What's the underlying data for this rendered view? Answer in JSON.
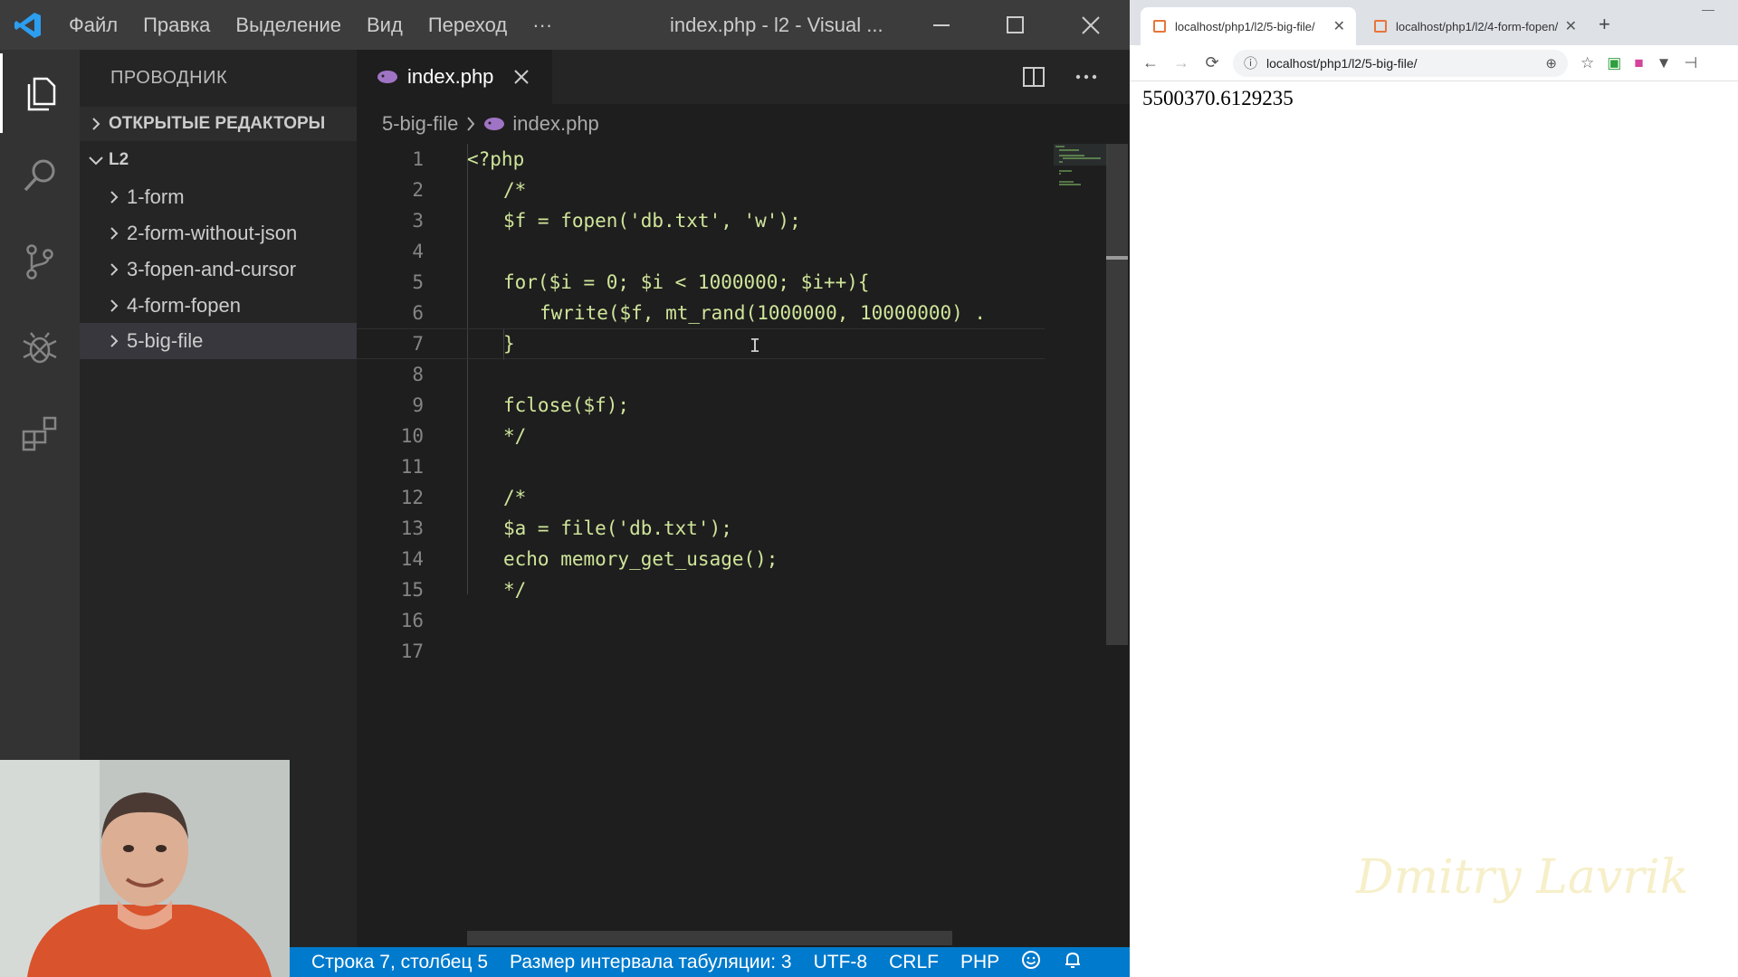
{
  "vscode": {
    "menu": [
      "Файл",
      "Правка",
      "Выделение",
      "Вид",
      "Переход",
      "···"
    ],
    "window_title": "index.php - l2 - Visual ...",
    "sidebar": {
      "header": "ПРОВОДНИК",
      "open_editors": "ОТКРЫТЫЕ РЕДАКТОРЫ",
      "folder": "L2",
      "items": [
        "1-form",
        "2-form-without-json",
        "3-fopen-and-cursor",
        "4-form-fopen",
        "5-big-file"
      ]
    },
    "tab": {
      "label": "index.php"
    },
    "breadcrumb": {
      "folder": "5-big-file",
      "file": "index.php"
    },
    "code": {
      "line_numbers": [
        "1",
        "2",
        "3",
        "4",
        "5",
        "6",
        "7",
        "8",
        "9",
        "10",
        "11",
        "12",
        "13",
        "14",
        "15",
        "16",
        "17"
      ],
      "lines": [
        "<?php",
        "/*",
        "$f = fopen('db.txt', 'w');",
        "",
        "for($i = 0; $i < 1000000; $i++){",
        "fwrite($f, mt_rand(1000000, 10000000) .",
        "}",
        "",
        "fclose($f);",
        "*/",
        "",
        "/*",
        "$a = file('db.txt');",
        "echo memory_get_usage();",
        "*/",
        "",
        ""
      ]
    },
    "status": {
      "position": "Строка 7, столбец 5",
      "tab_size": "Размер интервала табуляции: 3",
      "encoding": "UTF-8",
      "eol": "CRLF",
      "language": "PHP"
    },
    "icons": {
      "activity": [
        "explorer-icon",
        "search-icon",
        "source-control-icon",
        "debug-icon",
        "extensions-icon"
      ]
    },
    "colors": {
      "accent": "#007acc",
      "code_text": "#cfe59a",
      "php_tag": "#569cd6"
    }
  },
  "browser": {
    "tabs": [
      "localhost/php1/l2/5-big-file/",
      "localhost/php1/l2/4-form-fopen/"
    ],
    "url": "localhost/php1/l2/5-big-file/",
    "output": "5500370.6129235",
    "watermark": "Dmitry Lavrik"
  }
}
